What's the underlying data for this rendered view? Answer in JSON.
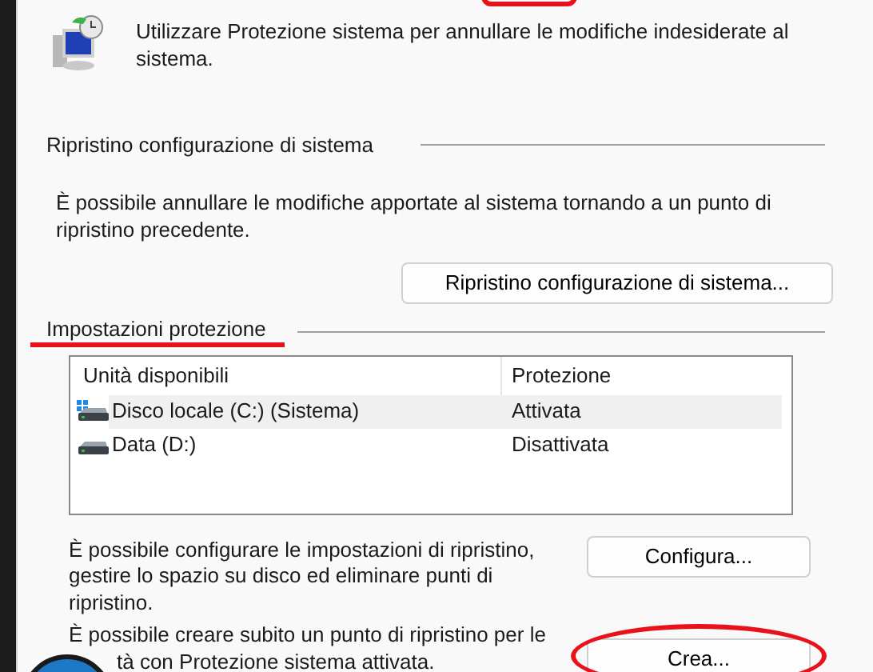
{
  "intro": "Utilizzare Protezione sistema per annullare le modifiche indesiderate al sistema.",
  "restore_section": {
    "title": "Ripristino configurazione di sistema",
    "text": "È possibile annullare le modifiche apportate al sistema tornando a un punto di ripristino precedente.",
    "button": "Ripristino configurazione di sistema..."
  },
  "protection_section": {
    "title": "Impostazioni protezione",
    "table": {
      "columns": [
        "Unità disponibili",
        "Protezione"
      ],
      "rows": [
        {
          "drive": "Disco locale (C:) (Sistema)",
          "protection": "Attivata",
          "system": true,
          "selected": true
        },
        {
          "drive": "Data (D:)",
          "protection": "Disattivata",
          "system": false,
          "selected": false
        }
      ]
    },
    "configure_text": "È possibile configurare le impostazioni di ripristino, gestire lo spazio su disco ed eliminare punti di ripristino.",
    "configure_button": "Configura...",
    "create_text_line1": "È possibile creare subito un punto di ripristino per le",
    "create_text_line2": "tà con Protezione sistema attivata.",
    "create_button": "Crea..."
  }
}
